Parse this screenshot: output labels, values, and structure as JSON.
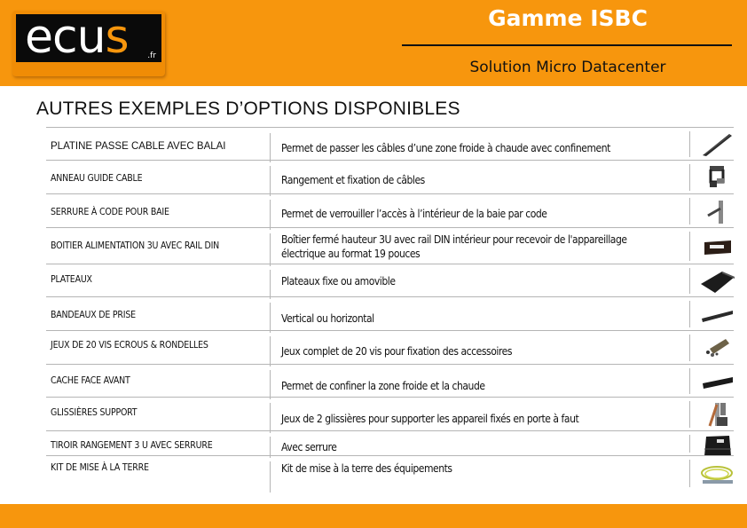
{
  "header": {
    "logo": {
      "text_main": "ecu",
      "text_accent": "s",
      "tld": ".fr"
    },
    "title": "Gamme ISBC",
    "subtitle": "Solution Micro Datacenter"
  },
  "section_title": "AUTRES EXEMPLES D’OPTIONS DISPONIBLES",
  "options": [
    {
      "name": "PLATINE PASSE CABLE AVEC BALAI",
      "description": "Permet de passer les câbles d’une zone froide à chaude avec confinement",
      "image": "brush-plate-icon"
    },
    {
      "name": "ANNEAU GUIDE CABLE",
      "description": "Rangement et fixation de câbles",
      "image": "cable-ring-icon"
    },
    {
      "name": "SERRURE À CODE POUR BAIE",
      "description": "Permet de verrouiller l’accès à l’intérieur de la baie par code",
      "image": "code-lock-icon"
    },
    {
      "name": "BOITIER ALIMENTATION 3U AVEC RAIL DIN",
      "description": "Boîtier fermé hauteur 3U avec rail DIN intérieur pour recevoir de l'appareillage électrique au format 19 pouces",
      "image": "power-box-icon"
    },
    {
      "name": "PLATEAUX",
      "description": "Plateaux fixe ou amovible",
      "image": "shelf-tray-icon"
    },
    {
      "name": "BANDEAUX DE PRISE",
      "description": "Vertical ou horizontal",
      "image": "power-strip-icon"
    },
    {
      "name": "JEUX DE 20 VIS ECROUS & RONDELLES",
      "description": "Jeux complet de 20 vis pour fixation des accessoires",
      "image": "screws-kit-icon"
    },
    {
      "name": "CACHE FACE AVANT",
      "description": "Permet de confiner la zone froide et la chaude",
      "image": "blank-panel-icon"
    },
    {
      "name": "GLISSIÈRES SUPPORT",
      "description": "Jeux de 2 glissières pour supporter les appareil fixés en porte à faut",
      "image": "rails-icon"
    },
    {
      "name": "TIROIR RANGEMENT 3 U AVEC SERRURE",
      "description": "Avec serrure",
      "image": "drawer-icon"
    },
    {
      "name": "KIT DE MISE À LA TERRE",
      "description": "Kit de mise à la terre des équipements",
      "image": "ground-cable-icon"
    }
  ],
  "colors": {
    "brand_orange": "#f7960d",
    "text": "#111111",
    "rule": "#b5b5b5"
  }
}
